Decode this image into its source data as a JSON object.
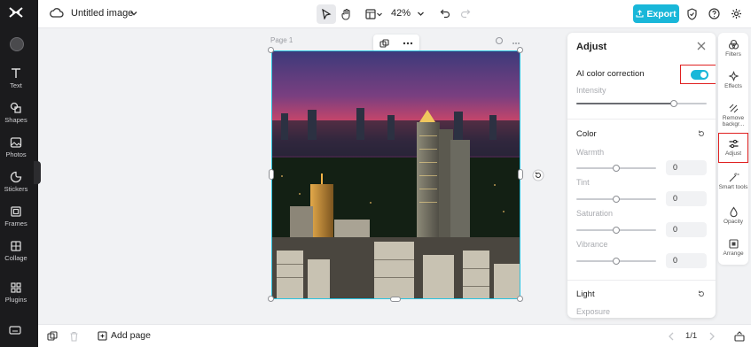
{
  "topbar": {
    "doc_title": "Untitled image",
    "zoom": "42%",
    "export_label": "Export"
  },
  "left_rail": {
    "items": [
      {
        "label": "Text",
        "icon": "text-icon"
      },
      {
        "label": "Shapes",
        "icon": "shapes-icon"
      },
      {
        "label": "Photos",
        "icon": "photos-icon"
      },
      {
        "label": "Stickers",
        "icon": "stickers-icon"
      },
      {
        "label": "Frames",
        "icon": "frames-icon"
      },
      {
        "label": "Collage",
        "icon": "collage-icon"
      },
      {
        "label": "Plugins",
        "icon": "plugins-icon"
      }
    ]
  },
  "canvas": {
    "page_label": "Page 1"
  },
  "panel": {
    "title": "Adjust",
    "ai_color_correction": {
      "label": "AI color correction",
      "enabled": true
    },
    "intensity": {
      "label": "Intensity",
      "value": 0.75
    },
    "color_section": "Color",
    "sliders": [
      {
        "label": "Warmth",
        "value": "0"
      },
      {
        "label": "Tint",
        "value": "0"
      },
      {
        "label": "Saturation",
        "value": "0"
      },
      {
        "label": "Vibrance",
        "value": "0"
      }
    ],
    "light_section": "Light",
    "exposure_label": "Exposure"
  },
  "right_rail": {
    "items": [
      {
        "label": "Filters",
        "icon": "filters-icon"
      },
      {
        "label": "Effects",
        "icon": "effects-icon"
      },
      {
        "label": "Remove backgr...",
        "icon": "remove-background-icon"
      },
      {
        "label": "Adjust",
        "icon": "adjust-icon"
      },
      {
        "label": "Smart tools",
        "icon": "smart-tools-icon"
      },
      {
        "label": "Opacity",
        "icon": "opacity-icon"
      },
      {
        "label": "Arrange",
        "icon": "arrange-icon"
      }
    ]
  },
  "bottombar": {
    "add_page_label": "Add page",
    "pager": "1/1"
  },
  "colors": {
    "accent": "#19b7d9",
    "highlight_box": "#e02020",
    "left_rail_bg": "#1b1b1d"
  }
}
